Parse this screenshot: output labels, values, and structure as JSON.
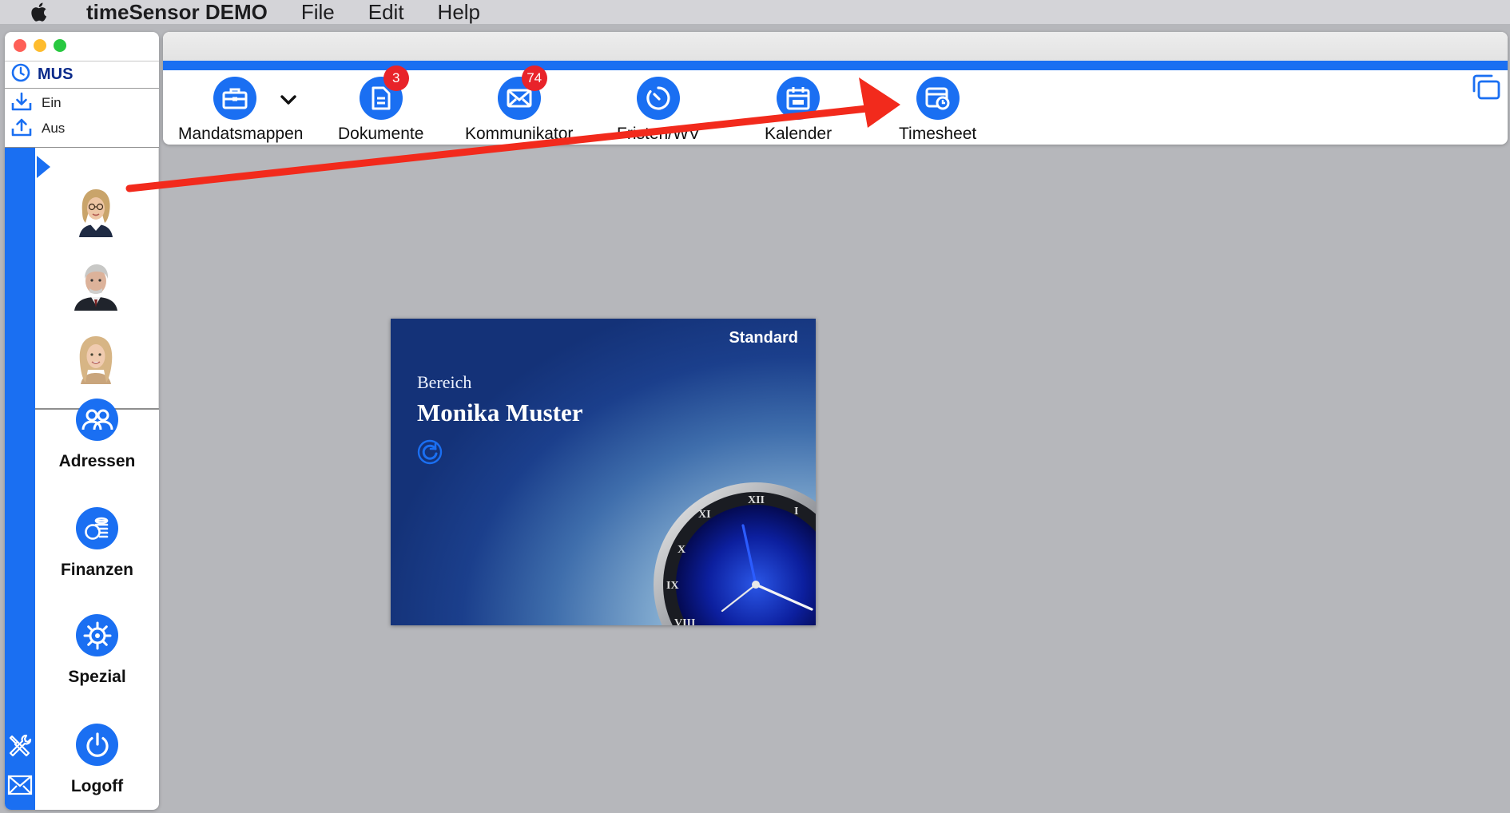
{
  "menubar": {
    "app_name": "timeSensor DEMO",
    "menus": [
      "File",
      "Edit",
      "Help"
    ]
  },
  "sidebar": {
    "user_code": "MUS",
    "clock_in": "Ein",
    "clock_out": "Aus",
    "nav": [
      {
        "label": "Adressen",
        "icon": "people-icon"
      },
      {
        "label": "Finanzen",
        "icon": "coins-icon"
      },
      {
        "label": "Spezial",
        "icon": "helm-icon"
      },
      {
        "label": "Logoff",
        "icon": "power-icon"
      }
    ]
  },
  "toolbar": {
    "items": [
      {
        "label": "Mandatsmappen",
        "icon": "briefcase-icon",
        "badge": ""
      },
      {
        "label": "Dokumente",
        "icon": "document-icon",
        "badge": "3"
      },
      {
        "label": "Kommunikator",
        "icon": "envelope-icon",
        "badge": "74"
      },
      {
        "label": "Fristen/WV",
        "icon": "timer-icon",
        "badge": ""
      },
      {
        "label": "Kalender",
        "icon": "calendar-icon",
        "badge": ""
      },
      {
        "label": "Timesheet",
        "icon": "timesheet-icon",
        "badge": ""
      }
    ]
  },
  "splash": {
    "edition": "Standard",
    "area_label": "Bereich",
    "person": "Monika Muster"
  },
  "colors": {
    "accent": "#1a6ff2",
    "badge": "#e8232a",
    "annotation": "#f22a1c"
  }
}
